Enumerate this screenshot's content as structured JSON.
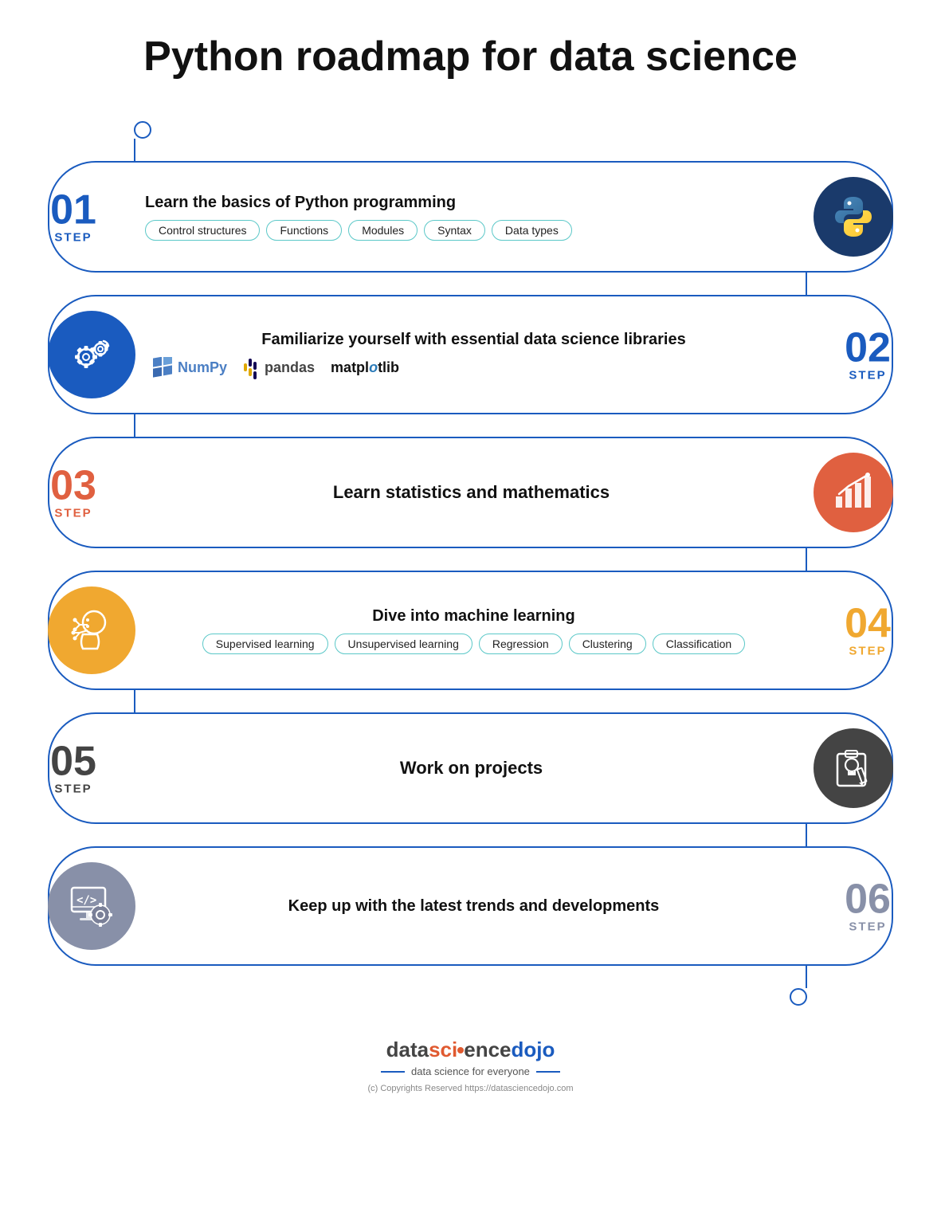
{
  "title": "Python roadmap for data science",
  "steps": [
    {
      "number": "01",
      "label": "STEP",
      "color": "#1a5bbf",
      "side": "right-icon",
      "title": "Learn the basics of Python programming",
      "tags": [
        "Control structures",
        "Functions",
        "Modules",
        "Syntax",
        "Data types"
      ],
      "icon_bg": "#1a3a6b",
      "icon_type": "python"
    },
    {
      "number": "02",
      "label": "STEP",
      "color": "#1a5bbf",
      "side": "left-icon",
      "title": "Familiarize yourself with essential data science libraries",
      "libs": [
        "NumPy",
        "pandas",
        "matplotlib"
      ],
      "icon_bg": "#1a5bbf",
      "icon_type": "gears"
    },
    {
      "number": "03",
      "label": "STEP",
      "color": "#e06040",
      "side": "right-icon",
      "title": "Learn statistics and mathematics",
      "icon_bg": "#e06040",
      "icon_type": "stats"
    },
    {
      "number": "04",
      "label": "STEP",
      "color": "#f0a830",
      "side": "left-icon",
      "title": "Dive into machine learning",
      "tags": [
        "Supervised learning",
        "Unsupervised learning",
        "Regression",
        "Clustering",
        "Classification"
      ],
      "icon_bg": "#f0a830",
      "icon_type": "ml"
    },
    {
      "number": "05",
      "label": "STEP",
      "color": "#444444",
      "side": "right-icon",
      "title": "Work on projects",
      "icon_bg": "#444444",
      "icon_type": "project"
    },
    {
      "number": "06",
      "label": "STEP",
      "color": "#8890a8",
      "side": "left-icon",
      "title": "Keep up with the latest trends and developments",
      "icon_bg": "#8890a8",
      "icon_type": "code"
    }
  ],
  "footer": {
    "logo_data": "data",
    "logo_sci": "sci",
    "logo_ence": "ence",
    "logo_dojo": "dojo",
    "tagline": "data science for everyone",
    "copyright": "(c) Copyrights Reserved  https://datasciencedojo.com"
  }
}
